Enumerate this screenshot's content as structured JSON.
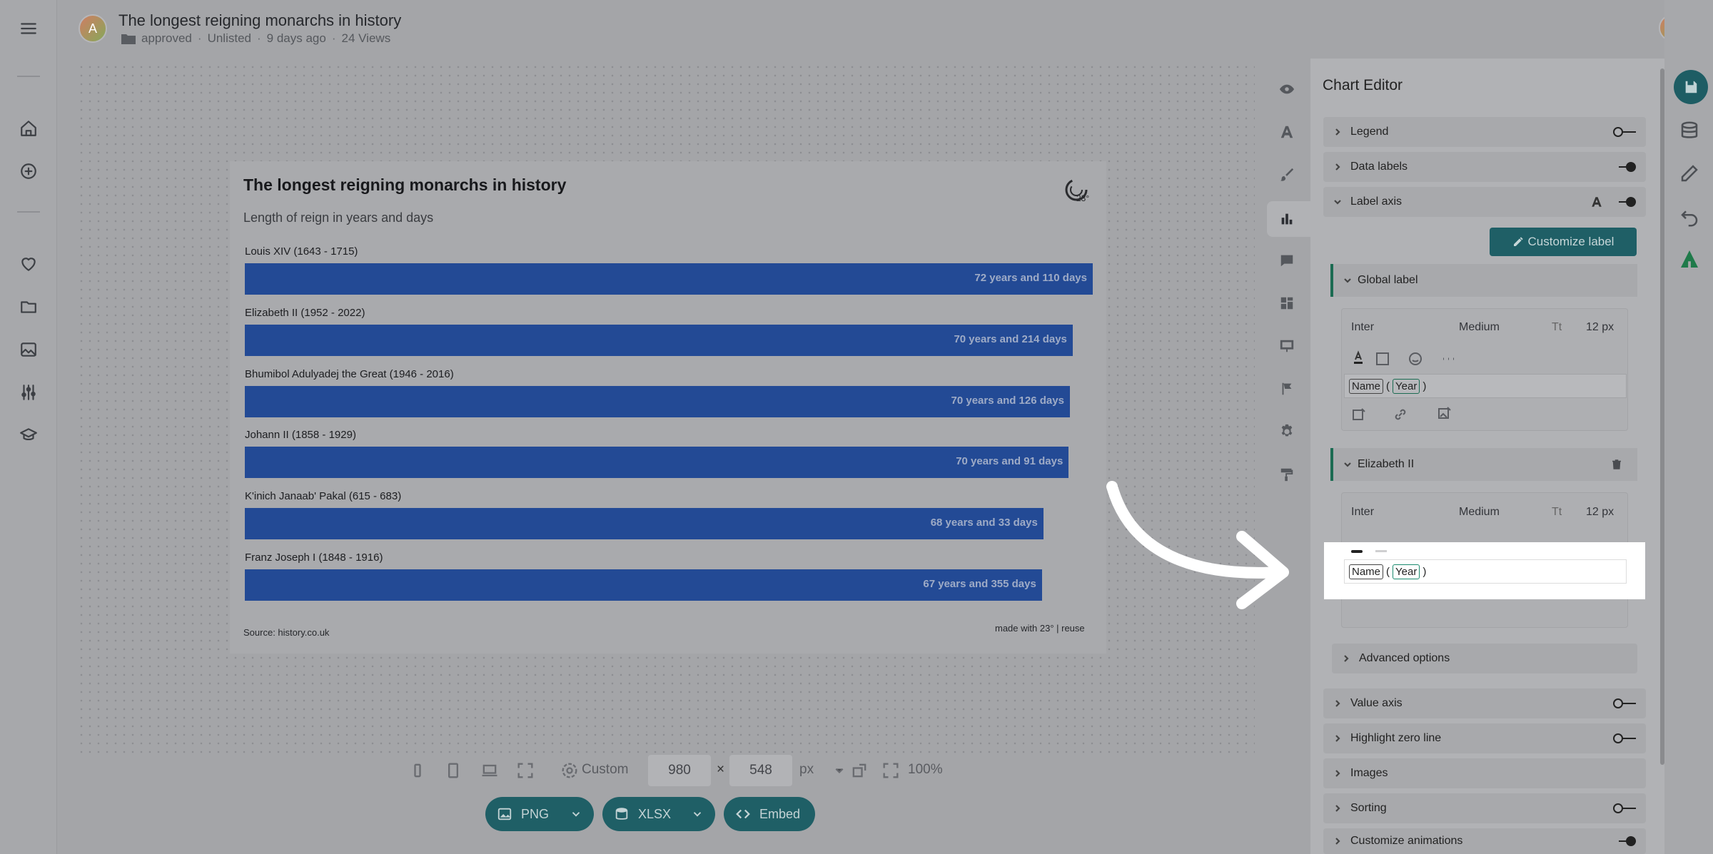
{
  "header": {
    "avatar_initial": "A",
    "title": "The longest reigning monarchs in history",
    "folder": "approved",
    "visibility": "Unlisted",
    "age": "9 days ago",
    "views": "24 Views"
  },
  "chart_data": {
    "type": "bar",
    "orientation": "horizontal",
    "title": "The longest reigning monarchs in history",
    "subtitle": "Length of reign in years and days",
    "categories": [
      "Louis XIV (1643 - 1715)",
      "Elizabeth II (1952 - 2022)",
      "Bhumibol Adulyadej the Great (1946 - 2016)",
      "Johann II (1858 - 1929)",
      "K'inich Janaab' Pakal (615 - 683)",
      "Franz Joseph I (1848 - 1916)"
    ],
    "values": [
      72.3,
      70.59,
      70.35,
      70.25,
      68.09,
      67.97
    ],
    "data_labels": [
      "72 years and 110 days",
      "70 years and 214 days",
      "70 years and 126 days",
      "70 years and 91 days",
      "68 years and 33 days",
      "67 years and 355 days"
    ],
    "bar_color": "#234a95",
    "source": "Source: history.co.uk",
    "credit": "made with 23° | reuse"
  },
  "toolbar": {
    "preset": "Custom",
    "width": "980",
    "height": "548",
    "unit": "px",
    "zoom": "100%",
    "export_png": "PNG",
    "export_xlsx": "XLSX",
    "embed": "Embed"
  },
  "editor": {
    "title": "Chart Editor",
    "sections": {
      "legend": "Legend",
      "data_labels": "Data labels",
      "label_axis": "Label axis",
      "value_axis": "Value axis",
      "highlight_zero_line": "Highlight zero line",
      "images": "Images",
      "sorting": "Sorting",
      "customize_animations": "Customize animations",
      "advanced_options": "Advanced options"
    },
    "customize_label_button": "Customize label",
    "global_label": {
      "heading": "Global label",
      "font": "Inter",
      "weight": "Medium",
      "size": "12 px",
      "field_name": "Name",
      "field_year": "Year"
    },
    "elizabeth_label": {
      "heading": "Elizabeth II",
      "font": "Inter",
      "weight": "Medium",
      "size": "12 px",
      "field_name": "Name",
      "field_year": "Year"
    }
  },
  "colors": {
    "accent": "#1f5f66",
    "bar": "#234a95"
  }
}
